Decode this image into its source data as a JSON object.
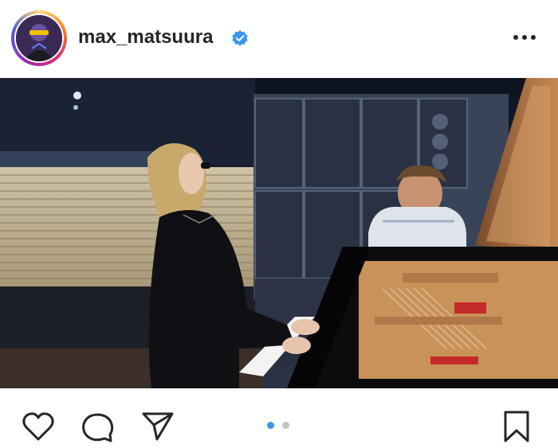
{
  "post": {
    "username": "max_matsuura",
    "verified": true,
    "icons": {
      "avatar": "avatar-image",
      "verified": "verified-badge-icon",
      "more": "more-options-icon"
    }
  },
  "media": {
    "description_icon": "photo",
    "carousel": {
      "total": 2,
      "active": 1
    }
  },
  "actions": {
    "like": "heart-icon",
    "comment": "comment-icon",
    "share": "send-icon",
    "save": "bookmark-icon"
  },
  "colors": {
    "verified": "#3897f0",
    "dot_active": "#3897f0",
    "dot_inactive": "#c4c4c4",
    "text": "#262626"
  }
}
